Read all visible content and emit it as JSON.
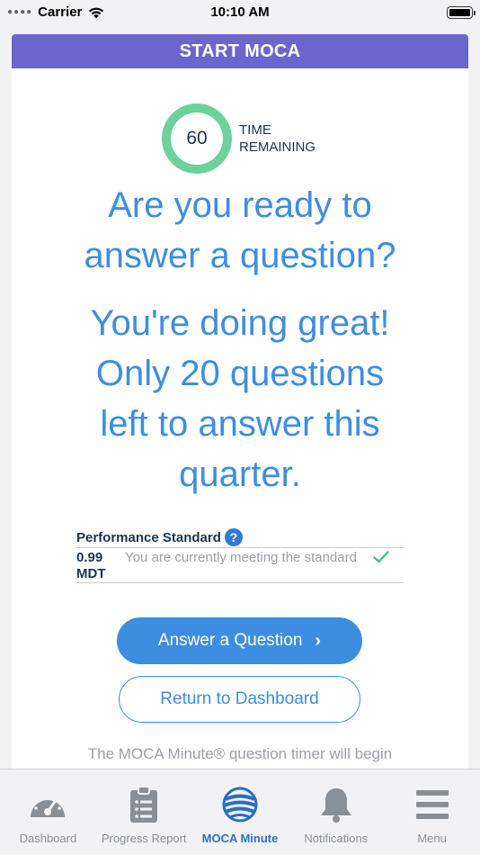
{
  "status_bar": {
    "carrier": "Carrier",
    "time": "10:10 AM"
  },
  "header": {
    "title": "START MOCA"
  },
  "timer": {
    "value": "60",
    "label_line1": "TIME",
    "label_line2": "REMAINING",
    "ring_color": "#6cd19a"
  },
  "prompt": {
    "line1": "Are you ready to",
    "line2": "answer a question?"
  },
  "encouragement": {
    "line1": "You're doing great!",
    "line2": "Only 20 questions",
    "line3": "left to answer this",
    "line4": "quarter."
  },
  "performance": {
    "title": "Performance Standard",
    "help_icon": "?",
    "value_line1": "0.99",
    "value_line2": "MDT",
    "status_text": "You are currently meeting the standard",
    "status_icon": "checkmark-icon"
  },
  "buttons": {
    "answer_label": "Answer a Question",
    "return_label": "Return to Dashboard"
  },
  "footnote": "The MOCA Minute® question timer will begin",
  "tabs": [
    {
      "label": "Dashboard",
      "icon": "gauge-icon",
      "active": false
    },
    {
      "label": "Progress Report",
      "icon": "clipboard-icon",
      "active": false
    },
    {
      "label": "MOCA Minute",
      "icon": "globe-icon",
      "active": true
    },
    {
      "label": "Notifications",
      "icon": "bell-icon",
      "active": false
    },
    {
      "label": "Menu",
      "icon": "hamburger-icon",
      "active": false
    }
  ],
  "colors": {
    "accent": "#3d8ee0",
    "header": "#6b66cc",
    "success": "#4fc27e"
  }
}
